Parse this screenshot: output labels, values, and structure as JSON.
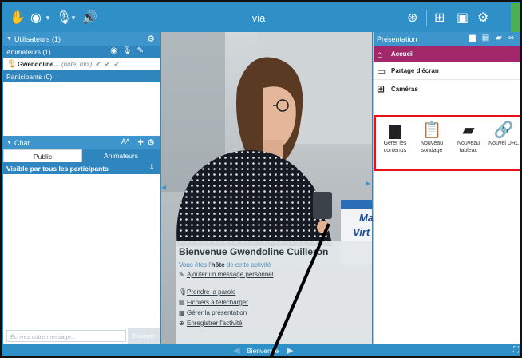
{
  "topbar": {
    "title": "via"
  },
  "users_panel": {
    "title": "Utilisateurs (1)",
    "animators_title": "Animateurs (1)",
    "user_name": "Gwendoline...",
    "user_role": "(hôte, moi)",
    "participants_title": "Participants (0)"
  },
  "chat_panel": {
    "title": "Chat",
    "font_btn": "Aᴬ",
    "tabs": [
      "Public",
      "Animateurs"
    ],
    "visibility_label": "Visible par tous les participants",
    "input_placeholder": "Écrivez votre message...",
    "send_label": "Envoyer"
  },
  "welcome": {
    "title": "Bienvenue Gwendoline Cuilleron",
    "subtitle_prefix": "Vous êtes l'",
    "subtitle_role": "hôte",
    "subtitle_suffix": " de cette activité",
    "add_message": "Ajouter un message personnel",
    "links": [
      "Prendre la parole",
      "Fichiers à télécharger",
      "Gérer la présentation",
      "Enregistrer l'activité"
    ],
    "screen_text_1": "Ma",
    "screen_text_2": "Virt"
  },
  "presentation": {
    "title": "Présentation",
    "menu": [
      "Accueil",
      "Partage d'écran",
      "Caméras"
    ],
    "tools": [
      {
        "line1": "Gérer les",
        "line2": "contenus"
      },
      {
        "line1": "Nouveau",
        "line2": "sondage"
      },
      {
        "line1": "Nouveau",
        "line2": "tableau"
      },
      {
        "line1": "Nouvel URL",
        "line2": ""
      }
    ]
  },
  "bottombar": {
    "label": "Bienvenue"
  },
  "colors": {
    "topbar": "#2f8fc7",
    "panel_header": "#3d95cc",
    "accueil_active": "#a3276b",
    "highlight_box": "#e8121b",
    "link": "#4a8ab8"
  }
}
